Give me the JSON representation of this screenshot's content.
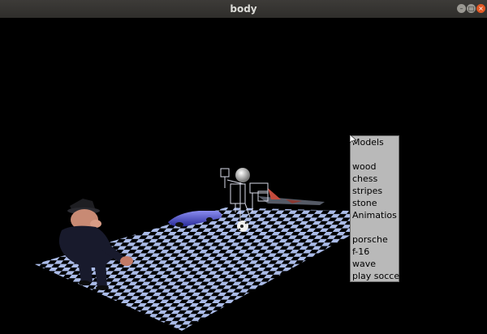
{
  "window": {
    "title": "body"
  },
  "popup_menu": {
    "items": [
      {
        "label": "Models"
      },
      {
        "label": ""
      },
      {
        "label": "wood"
      },
      {
        "label": "chess"
      },
      {
        "label": "stripes"
      },
      {
        "label": "stone"
      },
      {
        "label": "Animatios"
      },
      {
        "label": ""
      },
      {
        "label": "porsche"
      },
      {
        "label": "f-16"
      },
      {
        "label": "wave"
      },
      {
        "label": "play soccer"
      }
    ]
  },
  "colors": {
    "floor_light": "#aabbe8",
    "floor_dark": "#000000",
    "menu_bg": "#b9b9b9",
    "close_button": "#e25824"
  }
}
